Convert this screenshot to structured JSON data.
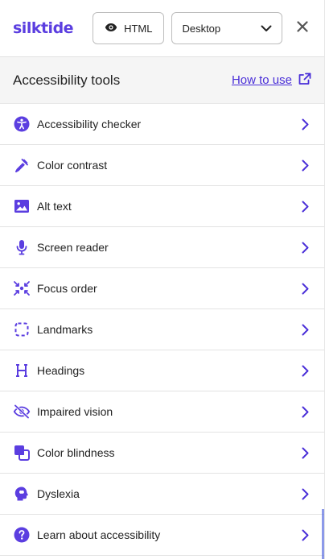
{
  "header": {
    "logo": "silktide",
    "html_button": "HTML",
    "device_select": "Desktop"
  },
  "section": {
    "title": "Accessibility tools",
    "how_to_use": "How to use"
  },
  "items": [
    {
      "label": "Accessibility checker",
      "icon": "accessibility-person-icon"
    },
    {
      "label": "Color contrast",
      "icon": "eyedropper-icon"
    },
    {
      "label": "Alt text",
      "icon": "image-icon"
    },
    {
      "label": "Screen reader",
      "icon": "microphone-icon"
    },
    {
      "label": "Focus order",
      "icon": "focus-arrows-icon"
    },
    {
      "label": "Landmarks",
      "icon": "dashed-square-icon"
    },
    {
      "label": "Headings",
      "icon": "heading-h-icon"
    },
    {
      "label": "Impaired vision",
      "icon": "eye-slash-icon"
    },
    {
      "label": "Color blindness",
      "icon": "overlapping-squares-icon"
    },
    {
      "label": "Dyslexia",
      "icon": "brain-head-icon"
    },
    {
      "label": "Learn about accessibility",
      "icon": "question-circle-icon"
    }
  ],
  "colors": {
    "accent": "#5b3ee0",
    "link": "#4a2fd8",
    "section_bg": "#f5f5f5"
  }
}
